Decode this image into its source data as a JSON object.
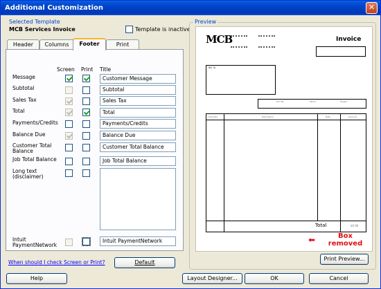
{
  "window": {
    "title": "Additional Customization",
    "close_glyph": "✕"
  },
  "selected_template": {
    "group_label": "Selected Template",
    "name": "MCB Services Invoice",
    "inactive_label": "Template is inactive",
    "inactive_checked": false
  },
  "tabs": [
    {
      "label": "Header",
      "active": false
    },
    {
      "label": "Columns",
      "active": false
    },
    {
      "label": "Footer",
      "active": true
    },
    {
      "label": "Print",
      "active": false
    }
  ],
  "columns": {
    "screen": "Screen",
    "print": "Print",
    "title": "Title"
  },
  "rows": [
    {
      "label": "Message",
      "screen": true,
      "screen_enabled": true,
      "print": true,
      "print_enabled": true,
      "title": "Customer Message"
    },
    {
      "label": "Subtotal",
      "screen": false,
      "screen_enabled": false,
      "print": false,
      "print_enabled": true,
      "title": "Subtotal"
    },
    {
      "label": "Sales Tax",
      "screen": true,
      "screen_enabled": false,
      "print": false,
      "print_enabled": true,
      "title": "Sales Tax"
    },
    {
      "label": "Total",
      "screen": true,
      "screen_enabled": false,
      "print": true,
      "print_enabled": true,
      "title": "Total"
    },
    {
      "label": "Payments/Credits",
      "screen": false,
      "screen_enabled": true,
      "print": false,
      "print_enabled": true,
      "title": "Payments/Credits"
    },
    {
      "label": "Balance Due",
      "screen": true,
      "screen_enabled": false,
      "print": false,
      "print_enabled": true,
      "title": "Balance Due"
    },
    {
      "label": "Customer Total Balance",
      "screen": false,
      "screen_enabled": true,
      "print": false,
      "print_enabled": true,
      "title": "Customer Total Balance"
    },
    {
      "label": "Job Total Balance",
      "screen": false,
      "screen_enabled": true,
      "print": false,
      "print_enabled": true,
      "title": "Job Total Balance"
    },
    {
      "label": "Long text (disclaimer)",
      "screen": false,
      "screen_enabled": true,
      "print": false,
      "print_enabled": true,
      "title": ""
    },
    {
      "label": "Intuit PaymentNetwork",
      "screen": false,
      "screen_enabled": false,
      "print": false,
      "print_enabled": true,
      "title": "Intuit PaymentNetwork"
    }
  ],
  "help_link": "When should I check Screen or Print?",
  "default_button": "Default",
  "preview": {
    "group_label": "Preview",
    "logo": "MCB",
    "doc_title": "Invoice",
    "bill_to": "Bill To",
    "col_headers": [
      "P.O. No.",
      "Terms",
      "Project"
    ],
    "item_headers": [
      "Quantity",
      "Description",
      "Rate",
      "Amount"
    ],
    "total_label": "Total",
    "total_value": "$0.00",
    "print_preview_button": "Print Preview...",
    "annotation": "Box removed",
    "annotation_arrow": "⬅",
    "colors": {
      "annotation": "#e01010"
    }
  },
  "footer_buttons": {
    "help": "Help",
    "layout_designer": "Layout Designer...",
    "ok": "OK",
    "cancel": "Cancel"
  }
}
